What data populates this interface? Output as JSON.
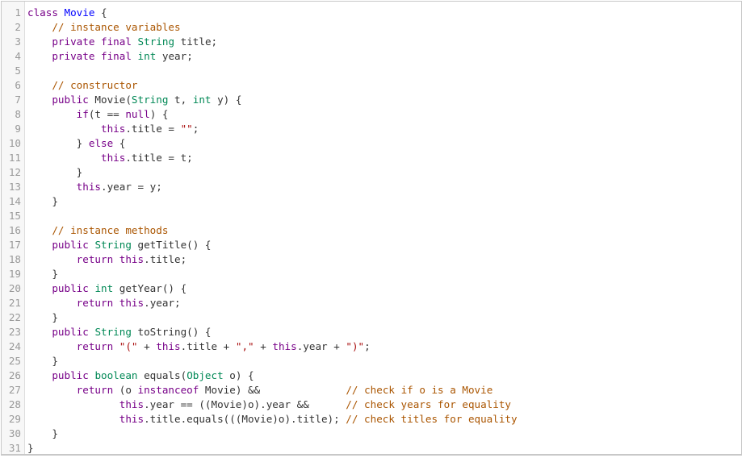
{
  "editor": {
    "colors": {
      "kw": "#770088",
      "ty": "#008855",
      "def": "#0000ff",
      "cm": "#aa5500",
      "st": "#aa1111",
      "plain": "#333333"
    },
    "lines": [
      [
        [
          "kw",
          "class"
        ],
        [
          "p",
          " "
        ],
        [
          "def",
          "Movie"
        ],
        [
          "p",
          " {"
        ]
      ],
      [
        [
          "p",
          "    "
        ],
        [
          "cm",
          "// instance variables"
        ]
      ],
      [
        [
          "p",
          "    "
        ],
        [
          "kw",
          "private"
        ],
        [
          "p",
          " "
        ],
        [
          "kw",
          "final"
        ],
        [
          "p",
          " "
        ],
        [
          "ty",
          "String"
        ],
        [
          "p",
          " title;"
        ]
      ],
      [
        [
          "p",
          "    "
        ],
        [
          "kw",
          "private"
        ],
        [
          "p",
          " "
        ],
        [
          "kw",
          "final"
        ],
        [
          "p",
          " "
        ],
        [
          "ty",
          "int"
        ],
        [
          "p",
          " year;"
        ]
      ],
      [],
      [
        [
          "p",
          "    "
        ],
        [
          "cm",
          "// constructor"
        ]
      ],
      [
        [
          "p",
          "    "
        ],
        [
          "kw",
          "public"
        ],
        [
          "p",
          " Movie("
        ],
        [
          "ty",
          "String"
        ],
        [
          "p",
          " t, "
        ],
        [
          "ty",
          "int"
        ],
        [
          "p",
          " y) {"
        ]
      ],
      [
        [
          "p",
          "        "
        ],
        [
          "kw",
          "if"
        ],
        [
          "p",
          "(t == "
        ],
        [
          "kw",
          "null"
        ],
        [
          "p",
          ") {"
        ]
      ],
      [
        [
          "p",
          "            "
        ],
        [
          "kw",
          "this"
        ],
        [
          "p",
          ".title = "
        ],
        [
          "st",
          "\"\""
        ],
        [
          "p",
          ";"
        ]
      ],
      [
        [
          "p",
          "        } "
        ],
        [
          "kw",
          "else"
        ],
        [
          "p",
          " {"
        ]
      ],
      [
        [
          "p",
          "            "
        ],
        [
          "kw",
          "this"
        ],
        [
          "p",
          ".title = t;"
        ]
      ],
      [
        [
          "p",
          "        }"
        ]
      ],
      [
        [
          "p",
          "        "
        ],
        [
          "kw",
          "this"
        ],
        [
          "p",
          ".year = y;"
        ]
      ],
      [
        [
          "p",
          "    }"
        ]
      ],
      [],
      [
        [
          "p",
          "    "
        ],
        [
          "cm",
          "// instance methods"
        ]
      ],
      [
        [
          "p",
          "    "
        ],
        [
          "kw",
          "public"
        ],
        [
          "p",
          " "
        ],
        [
          "ty",
          "String"
        ],
        [
          "p",
          " getTitle() {"
        ]
      ],
      [
        [
          "p",
          "        "
        ],
        [
          "kw",
          "return"
        ],
        [
          "p",
          " "
        ],
        [
          "kw",
          "this"
        ],
        [
          "p",
          ".title;"
        ]
      ],
      [
        [
          "p",
          "    }"
        ]
      ],
      [
        [
          "p",
          "    "
        ],
        [
          "kw",
          "public"
        ],
        [
          "p",
          " "
        ],
        [
          "ty",
          "int"
        ],
        [
          "p",
          " getYear() {"
        ]
      ],
      [
        [
          "p",
          "        "
        ],
        [
          "kw",
          "return"
        ],
        [
          "p",
          " "
        ],
        [
          "kw",
          "this"
        ],
        [
          "p",
          ".year;"
        ]
      ],
      [
        [
          "p",
          "    }"
        ]
      ],
      [
        [
          "p",
          "    "
        ],
        [
          "kw",
          "public"
        ],
        [
          "p",
          " "
        ],
        [
          "ty",
          "String"
        ],
        [
          "p",
          " toString() {"
        ]
      ],
      [
        [
          "p",
          "        "
        ],
        [
          "kw",
          "return"
        ],
        [
          "p",
          " "
        ],
        [
          "st",
          "\"(\""
        ],
        [
          "p",
          " + "
        ],
        [
          "kw",
          "this"
        ],
        [
          "p",
          ".title + "
        ],
        [
          "st",
          "\",\""
        ],
        [
          "p",
          " + "
        ],
        [
          "kw",
          "this"
        ],
        [
          "p",
          ".year + "
        ],
        [
          "st",
          "\")\""
        ],
        [
          "p",
          ";"
        ]
      ],
      [
        [
          "p",
          "    }"
        ]
      ],
      [
        [
          "p",
          "    "
        ],
        [
          "kw",
          "public"
        ],
        [
          "p",
          " "
        ],
        [
          "ty",
          "boolean"
        ],
        [
          "p",
          " equals("
        ],
        [
          "ty",
          "Object"
        ],
        [
          "p",
          " o) {"
        ]
      ],
      [
        [
          "p",
          "        "
        ],
        [
          "kw",
          "return"
        ],
        [
          "p",
          " (o "
        ],
        [
          "kw",
          "instanceof"
        ],
        [
          "p",
          " Movie) &&              "
        ],
        [
          "cm",
          "// check if o is a Movie"
        ]
      ],
      [
        [
          "p",
          "               "
        ],
        [
          "kw",
          "this"
        ],
        [
          "p",
          ".year == ((Movie)o).year &&      "
        ],
        [
          "cm",
          "// check years for equality"
        ]
      ],
      [
        [
          "p",
          "               "
        ],
        [
          "kw",
          "this"
        ],
        [
          "p",
          ".title.equals(((Movie)o).title); "
        ],
        [
          "cm",
          "// check titles for equality"
        ]
      ],
      [
        [
          "p",
          "    }"
        ]
      ],
      [
        [
          "p",
          "}"
        ]
      ]
    ]
  }
}
